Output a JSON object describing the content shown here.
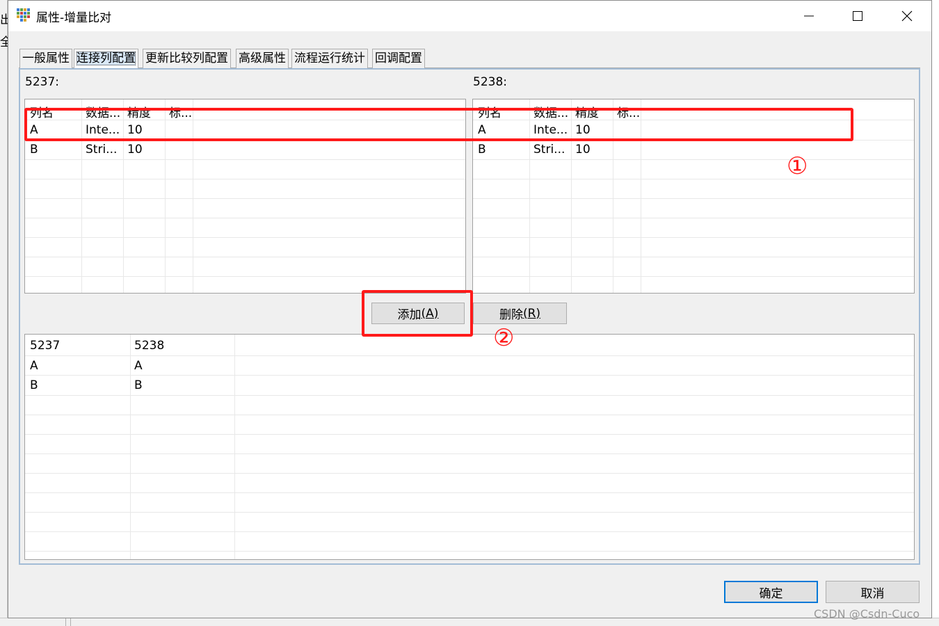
{
  "background": {
    "fragment_top": "出",
    "fragment_mid": "全"
  },
  "window": {
    "title": "属性-增量比对",
    "icon": "grid-app-icon",
    "controls": {
      "minimize": "minimize-icon",
      "maximize": "maximize-icon",
      "close": "close-icon"
    }
  },
  "tabs": [
    {
      "label": "一般属性",
      "active": false
    },
    {
      "label": "连接列配置",
      "active": true
    },
    {
      "label": "更新比较列配置",
      "active": false
    },
    {
      "label": "高级属性",
      "active": false
    },
    {
      "label": "流程运行统计",
      "active": false
    },
    {
      "label": "回调配置",
      "active": false
    }
  ],
  "left_pane": {
    "label": "5237:",
    "columns": [
      "列名",
      "数据...",
      "精度",
      "标..."
    ],
    "rows": [
      [
        "A",
        "Inte...",
        "10",
        ""
      ],
      [
        "B",
        "Stri...",
        "10",
        ""
      ]
    ]
  },
  "right_pane": {
    "label": "5238:",
    "columns": [
      "列名",
      "数据...",
      "精度",
      "标..."
    ],
    "rows": [
      [
        "A",
        "Inte...",
        "10",
        ""
      ],
      [
        "B",
        "Stri...",
        "10",
        ""
      ]
    ]
  },
  "buttons": {
    "add_label": "添加",
    "add_mnemonic": "(A)",
    "delete_label": "删除",
    "delete_mnemonic": "(R)",
    "ok": "确定",
    "cancel": "取消"
  },
  "mapping_table": {
    "columns": [
      "5237",
      "5238"
    ],
    "rows": [
      [
        "A",
        "A"
      ],
      [
        "B",
        "B"
      ]
    ]
  },
  "annotations": {
    "marker_1": "①",
    "marker_2": "②",
    "color": "#ff1a1a"
  },
  "watermark": "CSDN @Csdn-Cuco",
  "colors": {
    "accent": "#0078d7",
    "panel_border": "#a3bcd6"
  }
}
